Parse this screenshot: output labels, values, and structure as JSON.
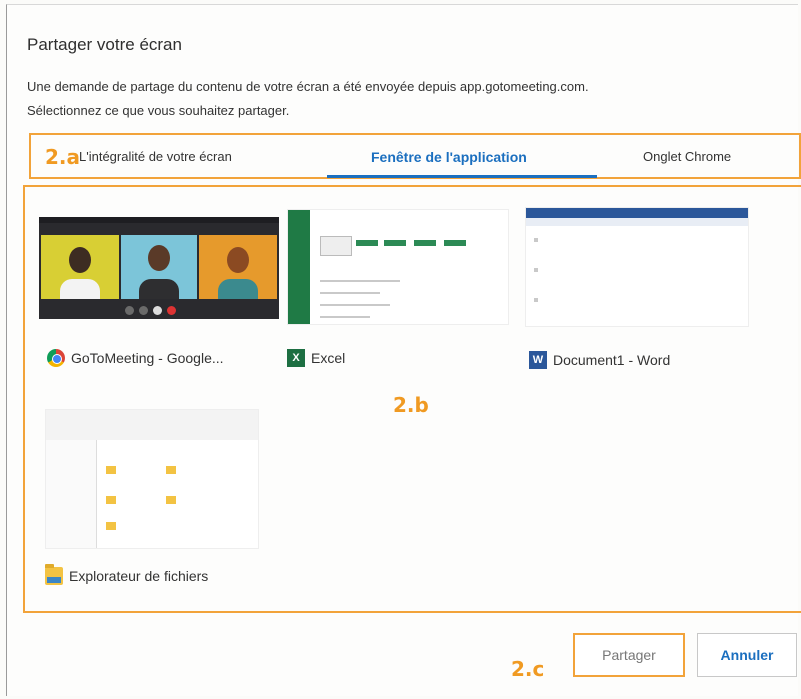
{
  "dialog": {
    "title": "Partager votre écran",
    "description_line1": "Une demande de partage du contenu de votre écran a été envoyée depuis app.gotomeeting.com.",
    "description_line2": "Sélectionnez ce que vous souhaitez partager."
  },
  "tabs": [
    {
      "label": "L'intégralité de votre écran",
      "selected": false
    },
    {
      "label": "Fenêtre de l'application",
      "selected": true
    },
    {
      "label": "Onglet Chrome",
      "selected": false
    }
  ],
  "windows": [
    {
      "label": "GoToMeeting - Google...",
      "icon": "chrome-icon"
    },
    {
      "label": "Excel",
      "icon": "excel-icon"
    },
    {
      "label": "Document1 - Word",
      "icon": "word-icon"
    },
    {
      "label": "Explorateur de fichiers",
      "icon": "folder-icon"
    }
  ],
  "icon_letters": {
    "excel": "X",
    "word": "W"
  },
  "annotations": {
    "tabs": "2.a",
    "grid": "2.b",
    "buttons": "2.c"
  },
  "buttons": {
    "share": "Partager",
    "cancel": "Annuler"
  },
  "colors": {
    "accent": "#1b6fbf",
    "annotation": "#f2a33a"
  }
}
